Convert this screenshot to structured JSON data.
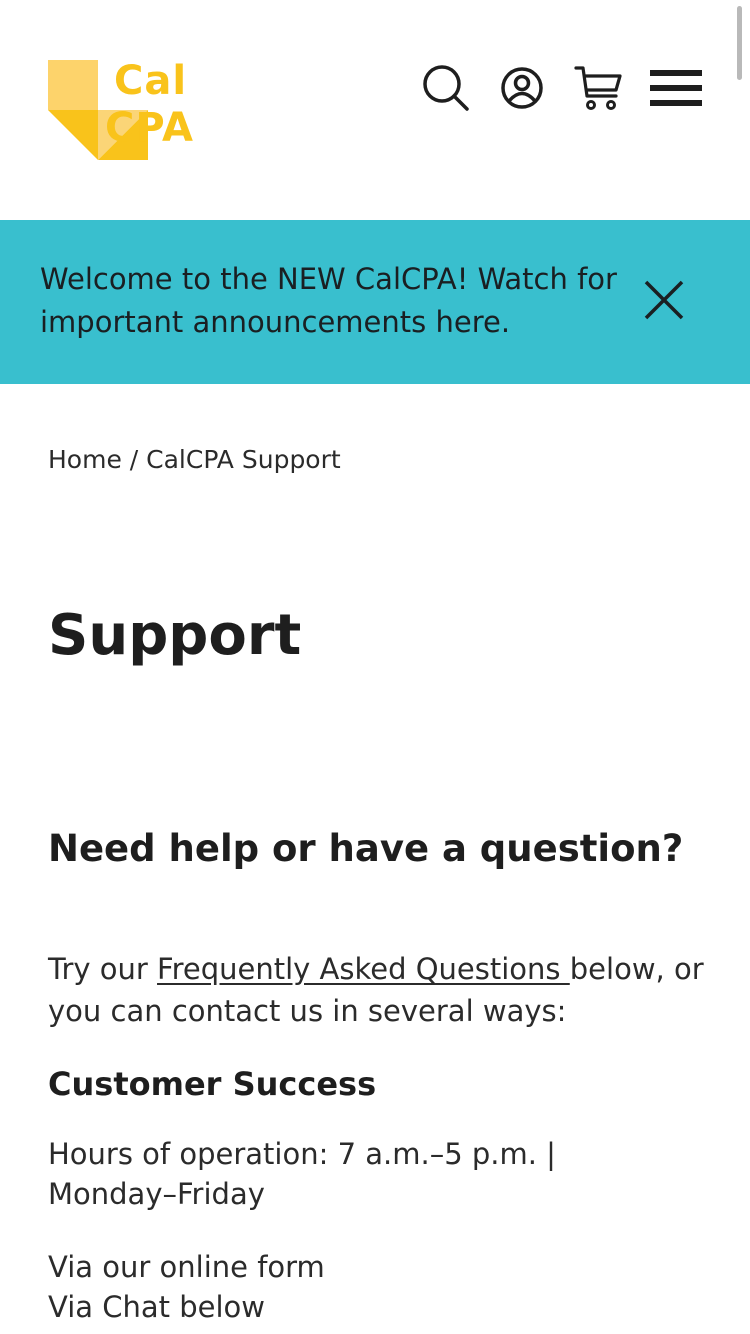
{
  "header": {
    "logo": {
      "line1": "Cal",
      "line2": "CPA",
      "color": "#f9c31b"
    },
    "icons": [
      "search-icon",
      "account-icon",
      "cart-icon",
      "menu-icon"
    ]
  },
  "announcement": {
    "text": "Welcome to the NEW CalCPA! Watch for important announcements here.",
    "background": "#39bfce",
    "close_icon": "close-icon"
  },
  "breadcrumb": {
    "home": "Home",
    "separator": " / ",
    "current": "CalCPA Support"
  },
  "main": {
    "title": "Support",
    "heading": "Need help or have a question?",
    "intro_before": "Try our ",
    "intro_link": "Frequently Asked Questions ",
    "intro_after": "below, or you can contact us in several ways:",
    "section_title": "Customer Success",
    "hours": "Hours of operation: 7 a.m.–5 p.m. | Monday–Friday",
    "contact_options": [
      "Via our online form",
      "Via Chat below"
    ]
  }
}
